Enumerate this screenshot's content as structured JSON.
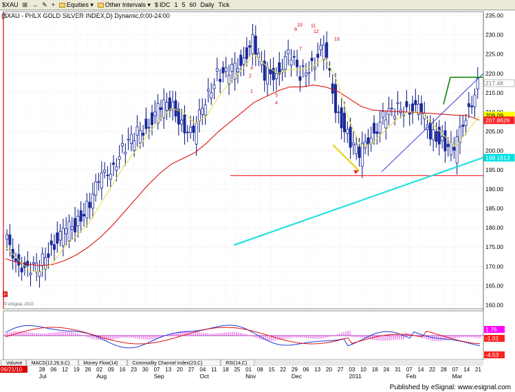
{
  "toolbar": {
    "symbol": "$XAU",
    "items": [
      {
        "icon": "pin-icon",
        "glyph": "⊞",
        "label": ""
      },
      {
        "icon": "arrow-icon",
        "glyph": "→",
        "label": ""
      },
      {
        "icon": "clear-icon",
        "glyph": "✎",
        "label": ""
      },
      {
        "icon": "add-icon",
        "glyph": "+",
        "label": ""
      },
      {
        "icon": "folder-icon",
        "glyph": "",
        "label": "Equities ▾"
      },
      {
        "icon": "folder-icon",
        "glyph": "",
        "label": "Other Intervals ▾"
      },
      {
        "icon": "",
        "glyph": "$",
        "label": "IDC"
      },
      {
        "icon": "",
        "glyph": "",
        "label": "1"
      },
      {
        "icon": "",
        "glyph": "",
        "label": "5"
      },
      {
        "icon": "",
        "glyph": "",
        "label": "60"
      },
      {
        "icon": "",
        "glyph": "",
        "label": "Daily"
      },
      {
        "icon": "",
        "glyph": "",
        "label": "Tick"
      }
    ]
  },
  "chart_data": {
    "type": "line",
    "title": "($XAU - PHLX GOLD SILVER INDEX,D) Dynamic,0:00-24:00",
    "price_axis": {
      "ticks": [
        235,
        230,
        225,
        220,
        215,
        210,
        205,
        200,
        195,
        190,
        185,
        180,
        175,
        170,
        165,
        160
      ],
      "range": [
        159,
        236
      ]
    },
    "price_labels": [
      {
        "value": 217.48,
        "text": "217.48",
        "bg": "#ffffff",
        "fg": "#7a7a7a"
      },
      {
        "value": 209.09,
        "text": "209.09",
        "bg": "#ffff00",
        "fg": "#000000"
      },
      {
        "value": 207.86,
        "text": "207.8626",
        "bg": "#ff2020",
        "fg": "#ffffff"
      },
      {
        "value": 198.16,
        "text": "198.1613",
        "bg": "#00e0e0",
        "fg": "#ffffff"
      }
    ],
    "date_axis": {
      "dates": [
        "21",
        "28",
        "06",
        "12",
        "19",
        "26",
        "02",
        "09",
        "16",
        "23",
        "30",
        "07",
        "13",
        "20",
        "27",
        "04",
        "11",
        "18",
        "25",
        "01",
        "08",
        "15",
        "22",
        "29",
        "06",
        "13",
        "20",
        "27",
        "03",
        "10",
        "18",
        "24",
        "31",
        "07",
        "14",
        "22",
        "28",
        "07",
        "14",
        "21"
      ],
      "months": [
        {
          "label": "Jul",
          "at": 1
        },
        {
          "label": "Aug",
          "at": 6
        },
        {
          "label": "Sep",
          "at": 11
        },
        {
          "label": "Oct",
          "at": 15
        },
        {
          "label": "Nov",
          "at": 19
        },
        {
          "label": "Dec",
          "at": 23
        },
        {
          "label": "2011",
          "at": 28
        },
        {
          "label": "Feb",
          "at": 33
        },
        {
          "label": "Mar",
          "at": 37
        }
      ],
      "first_date_label": "06/21/10"
    },
    "series": [
      {
        "name": "",
        "kind": "weekly_close",
        "values": [
          177,
          173,
          168,
          170,
          176,
          178,
          181,
          186,
          191,
          196,
          200,
          203,
          207,
          210,
          212,
          208,
          203,
          214,
          220,
          219,
          224,
          228,
          219,
          221,
          224,
          220,
          223,
          226,
          212,
          204,
          198,
          205,
          208,
          210,
          212,
          210,
          205,
          203,
          199,
          210,
          217
        ]
      },
      {
        "name": "",
        "kind": "ma_slow_red",
        "values": [
          172,
          171,
          170.5,
          170.2,
          170.5,
          171.5,
          173,
          175,
          177.5,
          180.5,
          184,
          187.5,
          191,
          194,
          196.5,
          198,
          199.5,
          202,
          205,
          207.5,
          210,
          212.5,
          214,
          215.5,
          216.5,
          216.5,
          217,
          216.5,
          215.5,
          213.5,
          211.5,
          210.5,
          210.3,
          210.1,
          210,
          209.8,
          209.6,
          209.4,
          209.2,
          209.1,
          207.9
        ]
      },
      {
        "name": "",
        "kind": "ma_fast_yellow",
        "values": [
          175,
          172,
          169,
          168.5,
          171,
          175,
          178,
          181,
          186,
          191,
          196,
          200,
          204,
          208,
          211,
          210,
          207,
          209,
          214,
          218,
          221,
          225,
          222,
          220,
          221,
          221,
          222,
          224,
          218,
          208,
          201,
          202,
          205,
          208,
          210,
          210,
          207,
          204,
          201,
          205,
          209
        ]
      }
    ],
    "indicators": {
      "labels": [
        "Volume",
        "MACD(12,26,9,C)",
        "Money Flow(14)",
        "Commodity Channel Index(23,C)",
        "RSI(14,C)"
      ],
      "macd_axis_labels": [
        {
          "text": "1.76",
          "bg": "#ff00ff",
          "fg": "#ffffff"
        },
        {
          "text": "-1.01",
          "bg": "#ff2020",
          "fg": "#ffffff"
        },
        {
          "text": "-4.53",
          "bg": "#ff2020",
          "fg": "#ffffff"
        }
      ]
    },
    "annotations": [
      "9",
      "10",
      "11",
      "12",
      "13",
      "7",
      "5",
      "4",
      "3",
      "2",
      "1"
    ]
  },
  "colors": {
    "accent_green": "#008800",
    "resistance_red": "#ff2020",
    "trend_cyan": "#22e0e0",
    "trend_blue": "#3b3bd8",
    "ma_red": "#dd1111",
    "ma_yellow": "#e6e04a"
  },
  "footer": "Published by eSignal: www.esignal.com"
}
